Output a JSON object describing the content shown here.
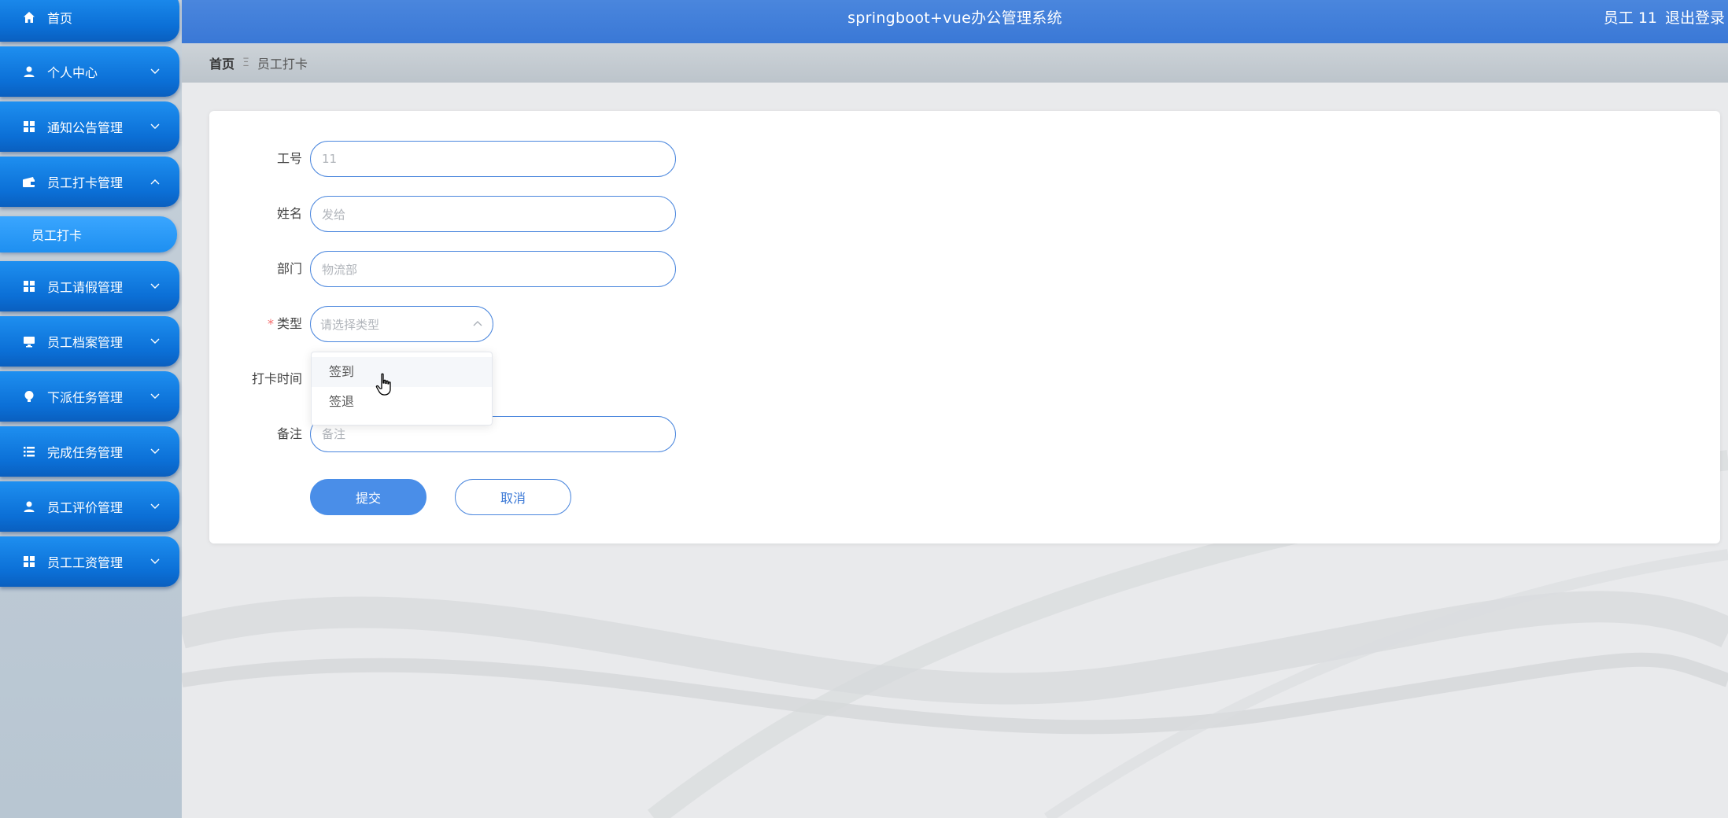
{
  "app": {
    "title": "springboot+vue办公管理系统",
    "user_label": "员工 11",
    "logout_label": "退出登录"
  },
  "sidebar": {
    "items": [
      {
        "label": "首页",
        "icon": "home-icon"
      },
      {
        "label": "个人中心",
        "icon": "user-icon"
      },
      {
        "label": "通知公告管理",
        "icon": "grid-icon"
      },
      {
        "label": "员工打卡管理",
        "icon": "wallet-icon"
      },
      {
        "label": "员工请假管理",
        "icon": "grid-icon"
      },
      {
        "label": "员工档案管理",
        "icon": "monitor-icon"
      },
      {
        "label": "下派任务管理",
        "icon": "bulb-icon"
      },
      {
        "label": "完成任务管理",
        "icon": "list-icon"
      },
      {
        "label": "员工评价管理",
        "icon": "user-icon"
      },
      {
        "label": "员工工资管理",
        "icon": "grid-icon"
      }
    ],
    "sub_item": "员工打卡"
  },
  "breadcrumb": {
    "home": "首页",
    "separator": "Ξ",
    "current": "员工打卡"
  },
  "form": {
    "employee_no": {
      "label": "工号",
      "value": "11"
    },
    "name": {
      "label": "姓名",
      "value": "发给"
    },
    "department": {
      "label": "部门",
      "value": "物流部"
    },
    "type": {
      "label": "类型",
      "required_mark": "*",
      "placeholder": "请选择类型"
    },
    "punch_time": {
      "label": "打卡时间"
    },
    "remark": {
      "label": "备注",
      "placeholder": "备注"
    },
    "submit_label": "提交",
    "cancel_label": "取消"
  },
  "type_dropdown": {
    "options": [
      "签到",
      "签退"
    ],
    "hovered_option": "签到"
  },
  "colors": {
    "topbar": "#3a78d6",
    "menu": "#0b6fd6",
    "accent": "#4a86dd",
    "required": "#f56c6c"
  }
}
